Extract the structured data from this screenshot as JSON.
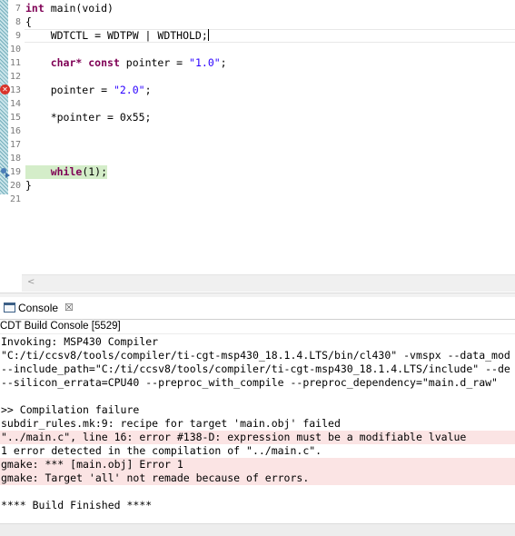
{
  "editor": {
    "lines": [
      {
        "num": "7",
        "pre": "",
        "kw": "int",
        "post": " main(void)",
        "str": "",
        "tail": ""
      },
      {
        "num": "8",
        "pre": "{",
        "kw": "",
        "post": "",
        "str": "",
        "tail": ""
      },
      {
        "num": "9",
        "pre": "    WDTCTL = WDTPW | WDTHOLD;",
        "kw": "",
        "post": "",
        "str": "",
        "tail": ""
      },
      {
        "num": "10",
        "pre": "",
        "kw": "",
        "post": "",
        "str": "",
        "tail": ""
      },
      {
        "num": "11",
        "pre": "    ",
        "kw": "char* const",
        "post": " pointer = ",
        "str": "\"1.0\"",
        "tail": ";"
      },
      {
        "num": "12",
        "pre": "",
        "kw": "",
        "post": "",
        "str": "",
        "tail": ""
      },
      {
        "num": "13",
        "pre": "    pointer = ",
        "kw": "",
        "post": "",
        "str": "\"2.0\"",
        "tail": ";"
      },
      {
        "num": "14",
        "pre": "",
        "kw": "",
        "post": "",
        "str": "",
        "tail": ""
      },
      {
        "num": "15",
        "pre": "    *pointer = 0x55;",
        "kw": "",
        "post": "",
        "str": "",
        "tail": ""
      },
      {
        "num": "16",
        "pre": "",
        "kw": "",
        "post": "",
        "str": "",
        "tail": ""
      },
      {
        "num": "17",
        "pre": "",
        "kw": "",
        "post": "",
        "str": "",
        "tail": ""
      },
      {
        "num": "18",
        "pre": "",
        "kw": "",
        "post": "",
        "str": "",
        "tail": ""
      },
      {
        "num": "19",
        "pre": "    ",
        "kw": "while",
        "post": "(1);",
        "str": "",
        "tail": ""
      },
      {
        "num": "20",
        "pre": "}",
        "kw": "",
        "post": "",
        "str": "",
        "tail": ""
      },
      {
        "num": "21",
        "pre": "",
        "kw": "",
        "post": "",
        "str": "",
        "tail": ""
      }
    ],
    "error_marker_icon": "error-icon",
    "breakpoint_icon": "breakpoint-icon",
    "scroll_left_arrow": "<"
  },
  "console": {
    "tab_label": "Console",
    "tab_close": "☒",
    "title": "CDT Build Console [5529]",
    "output": [
      {
        "text": "Invoking: MSP430 Compiler",
        "error": false
      },
      {
        "text": "\"C:/ti/ccsv8/tools/compiler/ti-cgt-msp430_18.1.4.LTS/bin/cl430\" -vmspx --data_mod",
        "error": false
      },
      {
        "text": "--include_path=\"C:/ti/ccsv8/tools/compiler/ti-cgt-msp430_18.1.4.LTS/include\" --de",
        "error": false
      },
      {
        "text": "--silicon_errata=CPU40 --preproc_with_compile --preproc_dependency=\"main.d_raw\"",
        "error": false
      },
      {
        "text": "",
        "error": false
      },
      {
        "text": ">> Compilation failure",
        "error": false
      },
      {
        "text": "subdir_rules.mk:9: recipe for target 'main.obj' failed",
        "error": false
      },
      {
        "text": "\"../main.c\", line 16: error #138-D: expression must be a modifiable lvalue",
        "error": true
      },
      {
        "text": "1 error detected in the compilation of \"../main.c\".",
        "error": false
      },
      {
        "text": "gmake: *** [main.obj] Error 1",
        "error": true
      },
      {
        "text": "gmake: Target 'all' not remade because of errors.",
        "error": true
      },
      {
        "text": "",
        "error": false
      },
      {
        "text": "**** Build Finished ****",
        "error": false
      }
    ]
  },
  "colors": {
    "keyword": "#7f0055",
    "string": "#2a00ff",
    "error_bg": "#fbe4e4",
    "highlight": "#d4edc9"
  }
}
